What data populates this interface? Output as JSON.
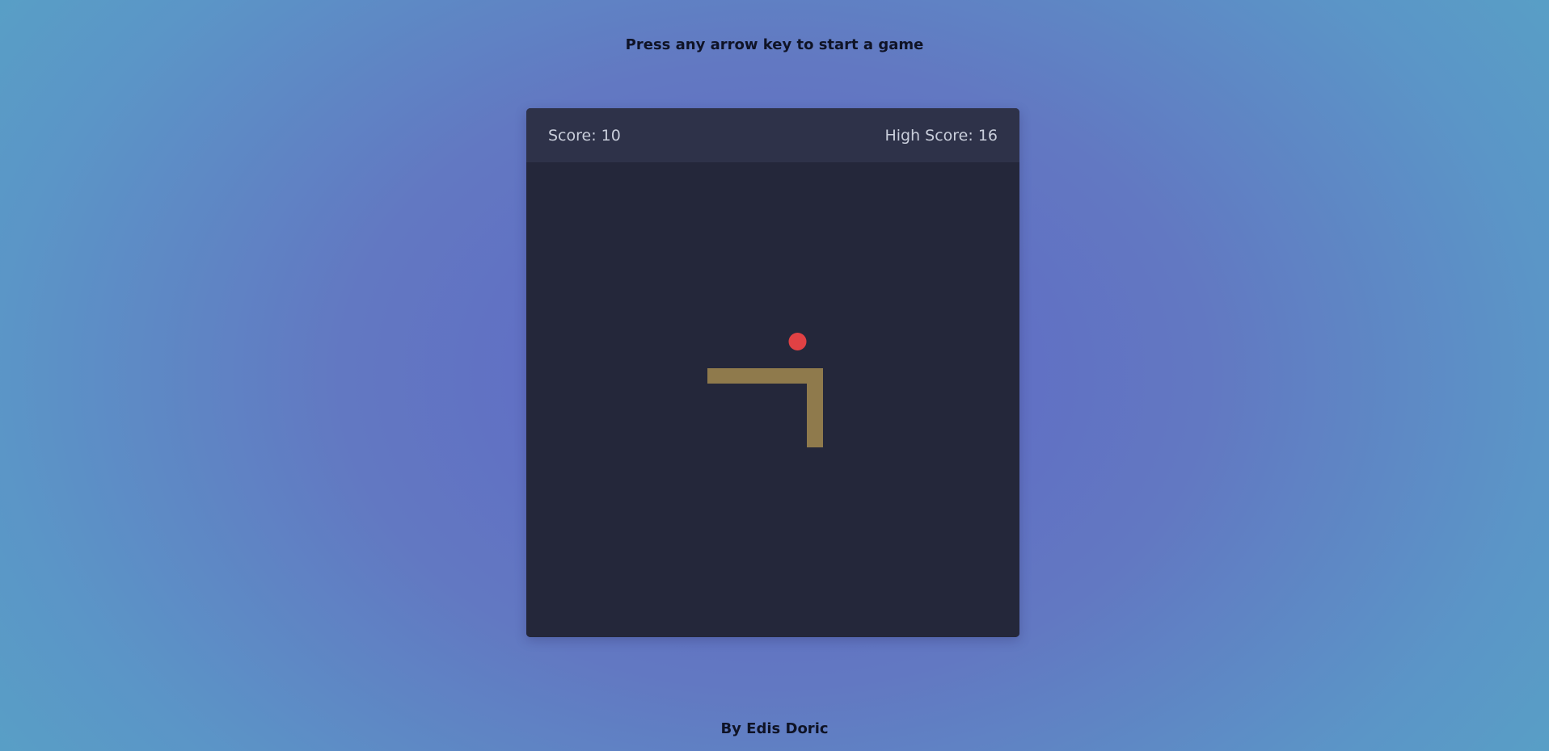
{
  "instructions": "Press any arrow key to start a game",
  "scoreboard": {
    "score_label": "Score: 10",
    "high_score_label": "High Score: 16"
  },
  "game": {
    "snake_color": "#8f7a4c",
    "food_color": "#e04144",
    "board_color": "#24273a",
    "header_color": "#2e3249"
  },
  "credit": "By Edis Doric"
}
